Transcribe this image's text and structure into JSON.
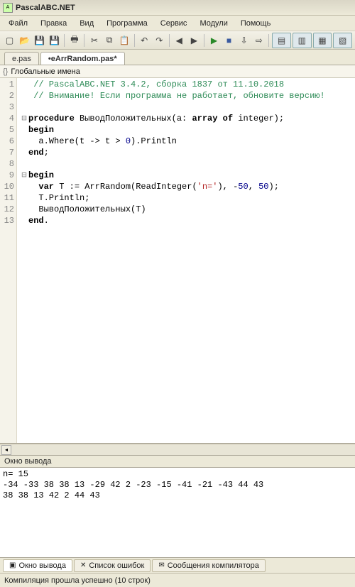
{
  "title": "PascalABC.NET",
  "menu": [
    "Файл",
    "Правка",
    "Вид",
    "Программа",
    "Сервис",
    "Модули",
    "Помощь"
  ],
  "toolbar_icons": [
    "new",
    "open",
    "save",
    "saveall",
    "sep",
    "print",
    "sep",
    "cut",
    "copy",
    "paste",
    "sep",
    "undo",
    "redo",
    "sep",
    "back",
    "fwd",
    "sep",
    "run",
    "stop",
    "stepinto",
    "stepover",
    "sep",
    "win1",
    "win2",
    "win3",
    "win4"
  ],
  "tabs": [
    {
      "label": "e.pas",
      "active": false
    },
    {
      "label": "•eArrRandom.pas*",
      "active": true
    }
  ],
  "names_pane": "Глобальные имена",
  "code": {
    "lines": [
      {
        "n": 1,
        "fold": "",
        "html": " <span class='c-comment'>// PascalABC.NET 3.4.2, сборка 1837 от 11.10.2018</span>"
      },
      {
        "n": 2,
        "fold": "",
        "html": " <span class='c-comment'>// Внимание! Если программа не работает, обновите версию!</span>"
      },
      {
        "n": 3,
        "fold": "",
        "html": ""
      },
      {
        "n": 4,
        "fold": "⊟",
        "html": "<span class='c-kw'>procedure</span> ВыводПоложительных(a: <span class='c-kw'>array of</span> integer);"
      },
      {
        "n": 5,
        "fold": "",
        "html": "<span class='c-kw'>begin</span>"
      },
      {
        "n": 6,
        "fold": "",
        "html": "  a.Where(t -&gt; t &gt; <span class='c-num'>0</span>).Println"
      },
      {
        "n": 7,
        "fold": "",
        "html": "<span class='c-kw'>end</span>;"
      },
      {
        "n": 8,
        "fold": "",
        "html": ""
      },
      {
        "n": 9,
        "fold": "⊟",
        "html": "<span class='c-kw'>begin</span>"
      },
      {
        "n": 10,
        "fold": "",
        "html": "  <span class='c-kw'>var</span> T := ArrRandom(ReadInteger(<span class='c-str'>'n='</span>), -<span class='c-num'>50</span>, <span class='c-num'>50</span>);"
      },
      {
        "n": 11,
        "fold": "",
        "html": "  T.Println;"
      },
      {
        "n": 12,
        "fold": "",
        "html": "  ВыводПоложительных(T)"
      },
      {
        "n": 13,
        "fold": "",
        "html": "<span class='c-kw'>end</span>."
      }
    ]
  },
  "output_title": "Окно вывода",
  "output_text": "n= 15\n-34 -33 38 38 13 -29 42 2 -23 -15 -41 -21 -43 44 43\n38 38 13 42 2 44 43",
  "bottom_tabs": [
    {
      "icon": "▣",
      "label": "Окно вывода",
      "active": true
    },
    {
      "icon": "✕",
      "label": "Список ошибок",
      "active": false
    },
    {
      "icon": "✉",
      "label": "Сообщения компилятора",
      "active": false
    }
  ],
  "status": "Компиляция прошла успешно (10 строк)"
}
